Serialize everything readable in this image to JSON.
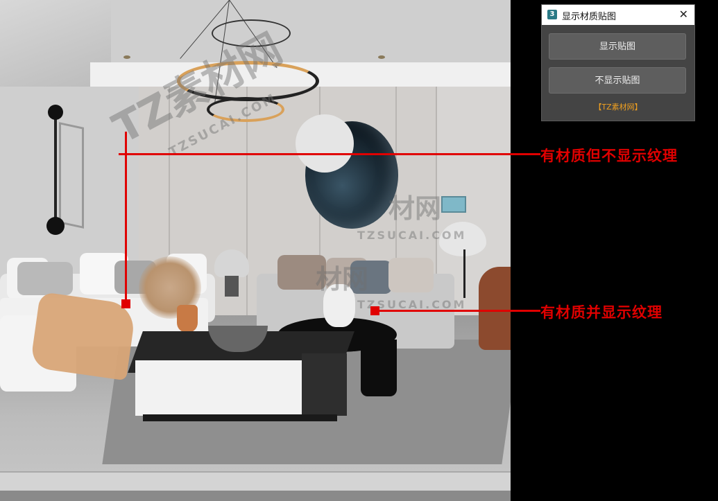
{
  "dialog": {
    "logo_text": "3",
    "title": "显示材质贴图",
    "close_glyph": "✕",
    "show_button_label": "显示贴图",
    "hide_button_label": "不显示贴图",
    "footer_text": "【TZ素材网】"
  },
  "annotations": {
    "upper_label": "有材质但不显示纹理",
    "lower_label": "有材质并显示纹理"
  },
  "watermarks": {
    "brand": "TZ素材网",
    "brand_short": "材网",
    "site": "TZSUCAI.COM"
  },
  "colors": {
    "annotation_red": "#e00000",
    "footer_orange": "#f0a020",
    "dialog_bg": "#444444",
    "button_bg": "#5e5e5e"
  },
  "icons": {
    "dialog_logo": "app-logo-icon",
    "close": "close-icon"
  }
}
